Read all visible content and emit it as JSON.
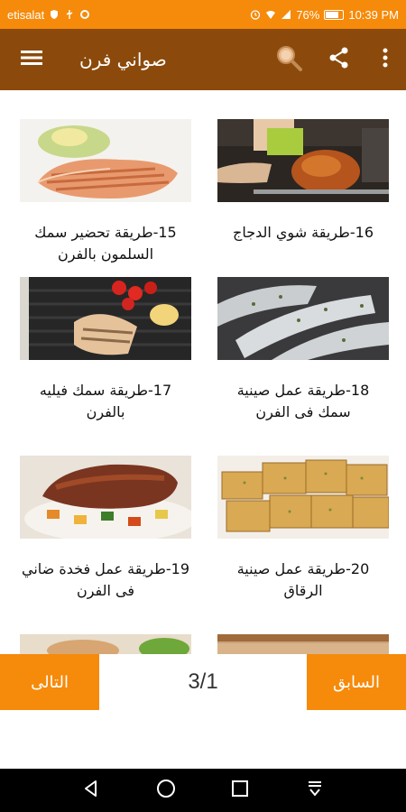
{
  "status_bar": {
    "carrier": "etisalat",
    "battery": "76%",
    "time": "10:39 PM"
  },
  "app_bar": {
    "title": "صواني فرن"
  },
  "recipes": [
    {
      "caption": "15-طريقة تحضير سمك السلمون بالفرن",
      "image": "salmon-photo"
    },
    {
      "caption": "16-طريقة شوي الدجاج",
      "image": "roast-chicken-photo"
    },
    {
      "caption": "17-طريقة سمك فيليه بالفرن",
      "image": "fish-fillet-photo"
    },
    {
      "caption": "18-طريقة عمل صينية سمك فى الفرن",
      "image": "baked-fish-tray-photo"
    },
    {
      "caption": "19-طريقة عمل فخدة ضاني فى الفرن",
      "image": "lamb-leg-photo"
    },
    {
      "caption": "20-طريقة عمل صينية الرقاق",
      "image": "roqaq-tray-photo"
    }
  ],
  "pager": {
    "next_label": "التالى",
    "prev_label": "السابق",
    "indicator": "3/1"
  },
  "colors": {
    "status_bar": "#F68A0A",
    "app_bar": "#8B4A0B",
    "accent": "#F68A0A"
  }
}
